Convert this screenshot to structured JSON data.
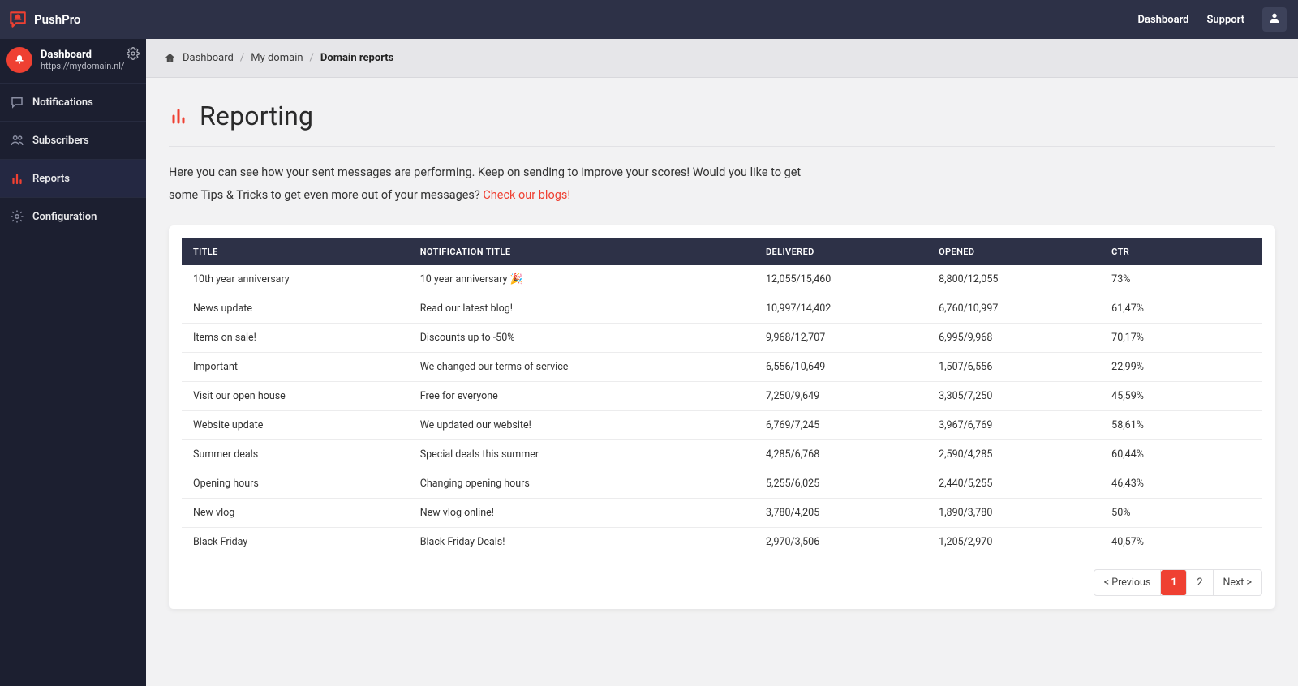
{
  "brand": {
    "name": "PushPro"
  },
  "topbar": {
    "links": [
      {
        "label": "Dashboard"
      },
      {
        "label": "Support"
      }
    ]
  },
  "sidebar": {
    "header": {
      "title": "Dashboard",
      "subtitle": "https://mydomain.nl/"
    },
    "items": [
      {
        "id": "notifications",
        "label": "Notifications"
      },
      {
        "id": "subscribers",
        "label": "Subscribers"
      },
      {
        "id": "reports",
        "label": "Reports"
      },
      {
        "id": "configuration",
        "label": "Configuration"
      }
    ]
  },
  "breadcrumbs": {
    "items": [
      "Dashboard",
      "My domain",
      "Domain reports"
    ]
  },
  "page": {
    "title": "Reporting",
    "intro_a": "Here you can see how your sent messages are performing. Keep on sending to improve your scores! Would you like to get some Tips & Tricks to get even more out of your messages? ",
    "intro_link": "Check our blogs!"
  },
  "table": {
    "headers": {
      "title": "Title",
      "notification_title": "Notification title",
      "delivered": "Delivered",
      "opened": "Opened",
      "ctr": "CTR"
    },
    "rows": [
      {
        "title": "10th year anniversary",
        "ntitle": "10 year anniversary 🎉",
        "delivered": "12,055/15,460",
        "opened": "8,800/12,055",
        "ctr": "73%"
      },
      {
        "title": "News update",
        "ntitle": "Read our latest blog!",
        "delivered": "10,997/14,402",
        "opened": "6,760/10,997",
        "ctr": "61,47%"
      },
      {
        "title": "Items on sale!",
        "ntitle": "Discounts up to -50%",
        "delivered": "9,968/12,707",
        "opened": "6,995/9,968",
        "ctr": "70,17%"
      },
      {
        "title": "Important",
        "ntitle": "We changed our terms of service",
        "delivered": "6,556/10,649",
        "opened": "1,507/6,556",
        "ctr": "22,99%"
      },
      {
        "title": "Visit our open house",
        "ntitle": "Free for everyone",
        "delivered": "7,250/9,649",
        "opened": "3,305/7,250",
        "ctr": "45,59%"
      },
      {
        "title": "Website update",
        "ntitle": "We updated our website!",
        "delivered": "6,769/7,245",
        "opened": "3,967/6,769",
        "ctr": "58,61%"
      },
      {
        "title": "Summer deals",
        "ntitle": "Special deals this summer",
        "delivered": "4,285/6,768",
        "opened": "2,590/4,285",
        "ctr": "60,44%"
      },
      {
        "title": "Opening hours",
        "ntitle": "Changing opening hours",
        "delivered": "5,255/6,025",
        "opened": "2,440/5,255",
        "ctr": "46,43%"
      },
      {
        "title": "New vlog",
        "ntitle": "New vlog online!",
        "delivered": "3,780/4,205",
        "opened": "1,890/3,780",
        "ctr": "50%"
      },
      {
        "title": "Black Friday",
        "ntitle": "Black Friday Deals!",
        "delivered": "2,970/3,506",
        "opened": "1,205/2,970",
        "ctr": "40,57%"
      }
    ]
  },
  "pagination": {
    "prev": "< Previous",
    "pages": [
      "1",
      "2"
    ],
    "active": "1",
    "next": "Next >"
  }
}
